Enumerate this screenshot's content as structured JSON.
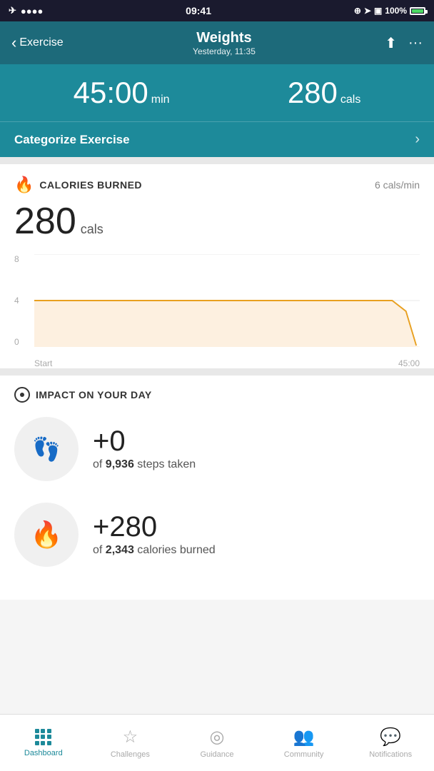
{
  "statusBar": {
    "time": "09:41",
    "battery": "100%",
    "signal": "●●●●"
  },
  "header": {
    "back_label": "Exercise",
    "title": "Weights",
    "subtitle": "Yesterday, 11:35"
  },
  "summary": {
    "duration_value": "45:00",
    "duration_unit": "min",
    "calories_value": "280",
    "calories_unit": "cals"
  },
  "categorize": {
    "label": "Categorize Exercise"
  },
  "caloriesBurned": {
    "section_title": "CALORIES BURNED",
    "rate": "6 cals/min",
    "value": "280",
    "unit": "cals",
    "chart_y": [
      "0",
      "4",
      "8"
    ],
    "chart_x_start": "Start",
    "chart_x_end": "45:00"
  },
  "impact": {
    "section_title": "IMPACT ON YOUR DAY",
    "steps": {
      "delta": "+0",
      "description_prefix": "of ",
      "description_bold": "9,936",
      "description_suffix": " steps taken"
    },
    "calories": {
      "delta": "+280",
      "description_prefix": "of ",
      "description_bold": "2,343",
      "description_suffix": " calories burned"
    }
  },
  "bottomNav": {
    "items": [
      {
        "id": "dashboard",
        "label": "Dashboard",
        "active": true
      },
      {
        "id": "challenges",
        "label": "Challenges",
        "active": false
      },
      {
        "id": "guidance",
        "label": "Guidance",
        "active": false
      },
      {
        "id": "community",
        "label": "Community",
        "active": false
      },
      {
        "id": "notifications",
        "label": "Notifications",
        "active": false
      }
    ]
  }
}
